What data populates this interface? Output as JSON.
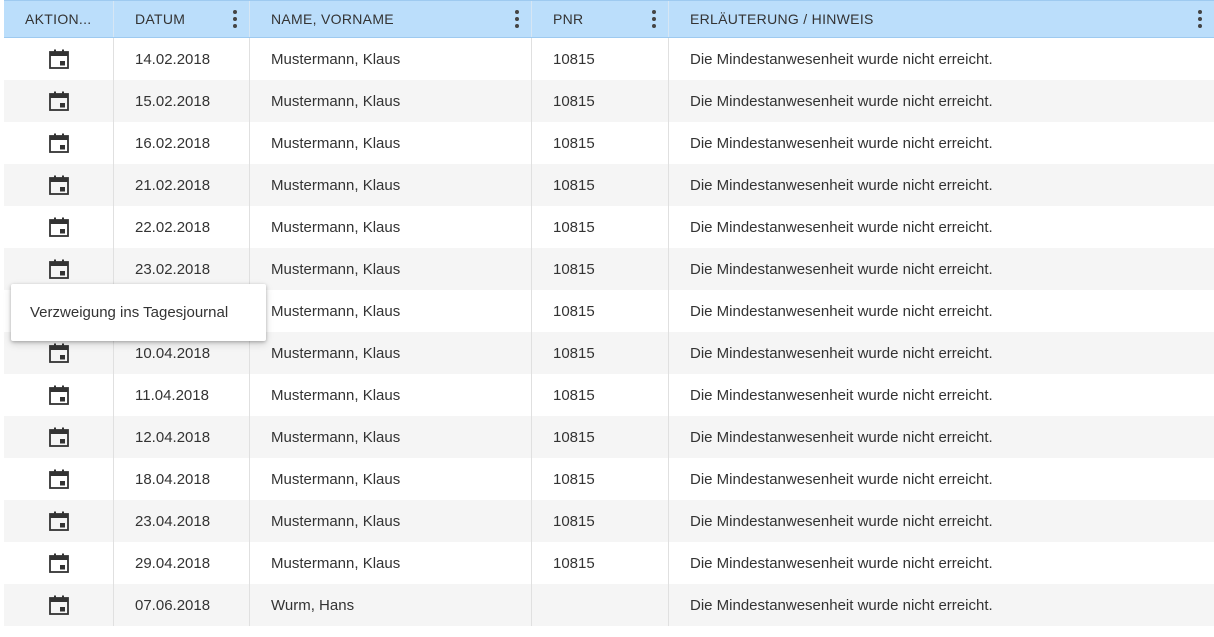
{
  "columns": [
    {
      "label": "AKTION..."
    },
    {
      "label": "DATUM"
    },
    {
      "label": "NAME, VORNAME"
    },
    {
      "label": "PNR"
    },
    {
      "label": "ERLÄUTERUNG / HINWEIS"
    }
  ],
  "rows": [
    {
      "date": "14.02.2018",
      "name": "Mustermann, Klaus",
      "pnr": "10815",
      "note": "Die Mindestanwesenheit wurde nicht erreicht."
    },
    {
      "date": "15.02.2018",
      "name": "Mustermann, Klaus",
      "pnr": "10815",
      "note": "Die Mindestanwesenheit wurde nicht erreicht."
    },
    {
      "date": "16.02.2018",
      "name": "Mustermann, Klaus",
      "pnr": "10815",
      "note": "Die Mindestanwesenheit wurde nicht erreicht."
    },
    {
      "date": "21.02.2018",
      "name": "Mustermann, Klaus",
      "pnr": "10815",
      "note": "Die Mindestanwesenheit wurde nicht erreicht."
    },
    {
      "date": "22.02.2018",
      "name": "Mustermann, Klaus",
      "pnr": "10815",
      "note": "Die Mindestanwesenheit wurde nicht erreicht."
    },
    {
      "date": "23.02.2018",
      "name": "Mustermann, Klaus",
      "pnr": "10815",
      "note": "Die Mindestanwesenheit wurde nicht erreicht."
    },
    {
      "date": "",
      "name": "Mustermann, Klaus",
      "pnr": "10815",
      "note": "Die Mindestanwesenheit wurde nicht erreicht."
    },
    {
      "date": "10.04.2018",
      "name": "Mustermann, Klaus",
      "pnr": "10815",
      "note": "Die Mindestanwesenheit wurde nicht erreicht."
    },
    {
      "date": "11.04.2018",
      "name": "Mustermann, Klaus",
      "pnr": "10815",
      "note": "Die Mindestanwesenheit wurde nicht erreicht."
    },
    {
      "date": "12.04.2018",
      "name": "Mustermann, Klaus",
      "pnr": "10815",
      "note": "Die Mindestanwesenheit wurde nicht erreicht."
    },
    {
      "date": "18.04.2018",
      "name": "Mustermann, Klaus",
      "pnr": "10815",
      "note": "Die Mindestanwesenheit wurde nicht erreicht."
    },
    {
      "date": "23.04.2018",
      "name": "Mustermann, Klaus",
      "pnr": "10815",
      "note": "Die Mindestanwesenheit wurde nicht erreicht."
    },
    {
      "date": "29.04.2018",
      "name": "Mustermann, Klaus",
      "pnr": "10815",
      "note": "Die Mindestanwesenheit wurde nicht erreicht."
    },
    {
      "date": "07.06.2018",
      "name": "Wurm, Hans",
      "pnr": "",
      "note": "Die Mindestanwesenheit wurde nicht erreicht."
    }
  ],
  "row_action_icon": "calendar-icon",
  "tooltip": {
    "text": "Verzweigung ins Tagesjournal"
  },
  "colors": {
    "header_bg": "#bbdefb",
    "row_alt_bg": "#f5f5f5",
    "text": "#333333"
  }
}
